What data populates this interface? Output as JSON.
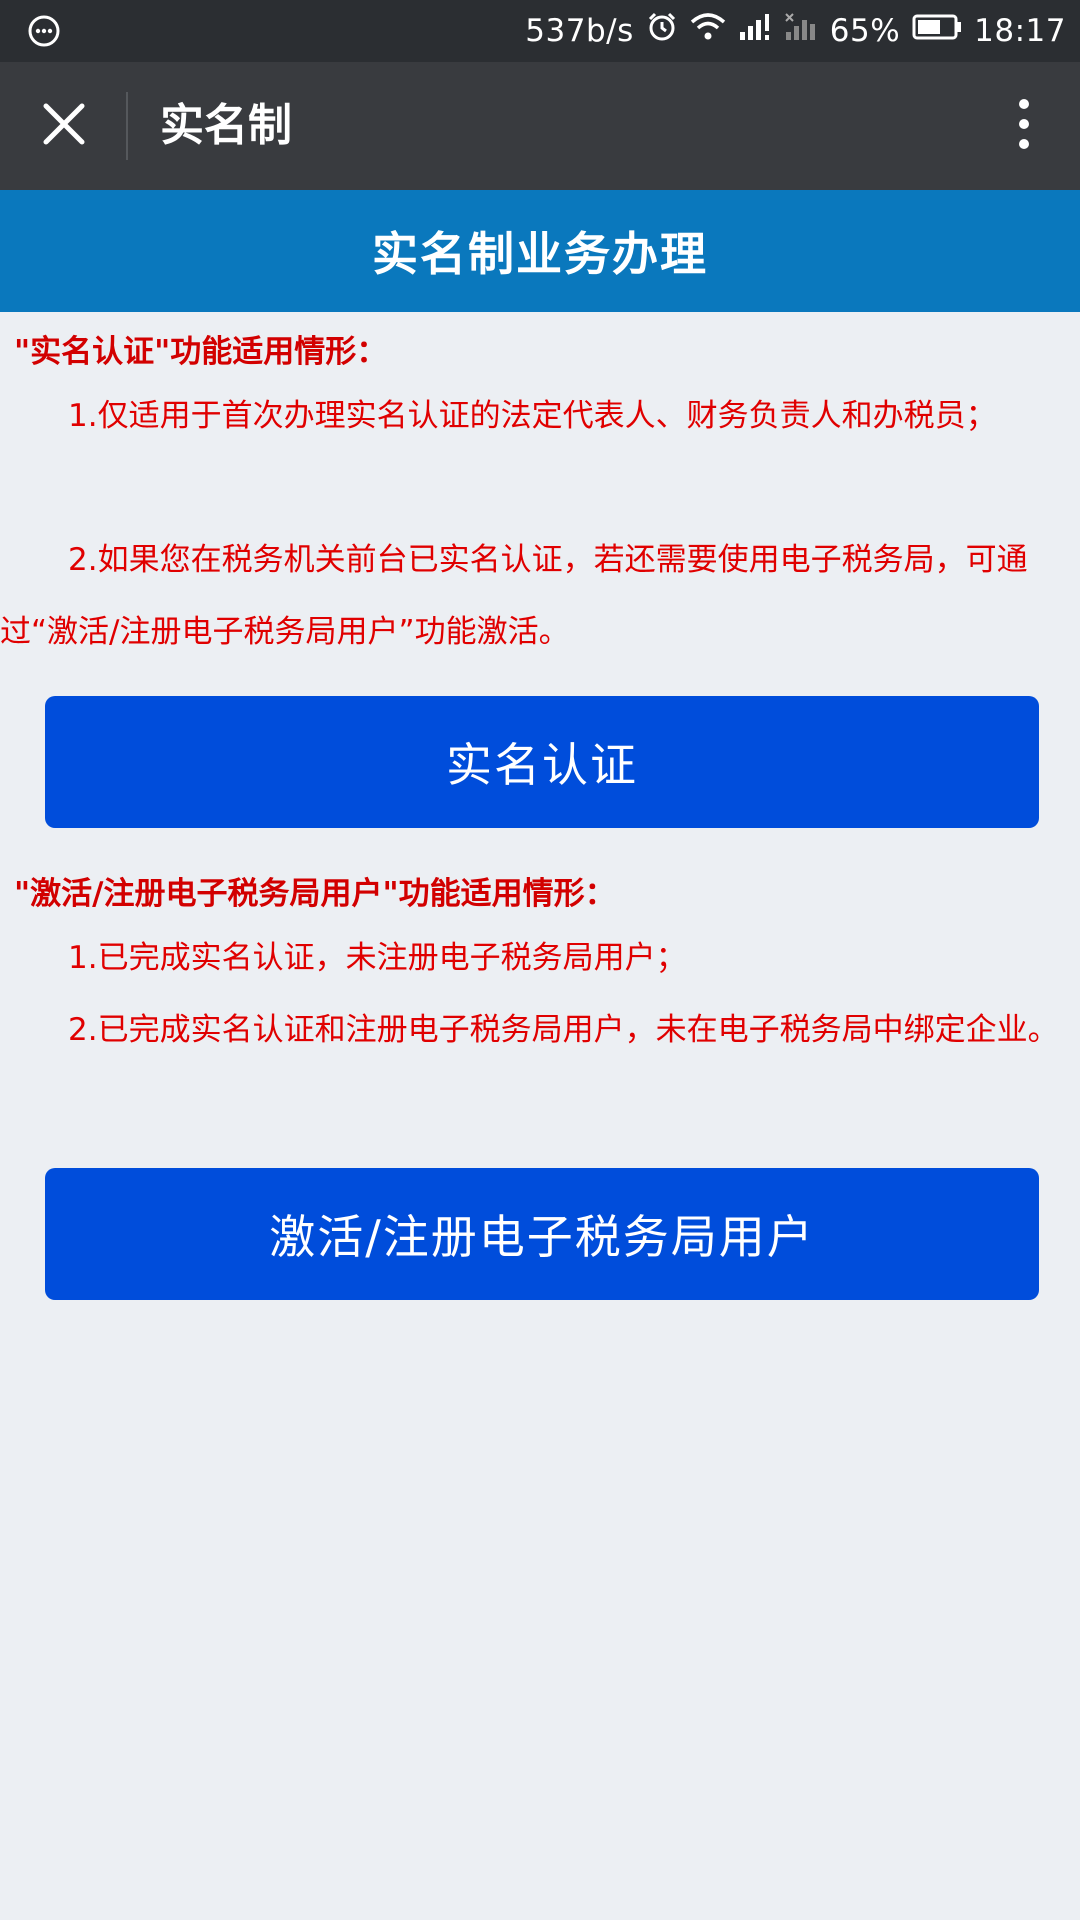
{
  "status_bar": {
    "net_speed": "537b/s",
    "battery_percent": "65%",
    "battery_level": 0.65,
    "time": "18:17",
    "icons": [
      "message-bubble-icon",
      "alarm-icon",
      "wifi-icon",
      "signal-icon",
      "signal-no-service-icon",
      "battery-icon"
    ]
  },
  "title_bar": {
    "title": "实名制"
  },
  "header": {
    "title": "实名制业务办理"
  },
  "section1": {
    "title": "\"实名认证\"功能适用情形：",
    "items": [
      "1.仅适用于首次办理实名认证的法定代表人、财务负责人和办税员；",
      "2.如果您在税务机关前台已实名认证，若还需要使用电子税务局，可通过“激活/注册电子税务局用户”功能激活。"
    ],
    "button": "实名认证"
  },
  "section2": {
    "title": "\"激活/注册电子税务局用户\"功能适用情形：",
    "items": [
      "1.已完成实名认证，未注册电子税务局用户；",
      "2.已完成实名认证和注册电子税务局用户，未在电子税务局中绑定企业。"
    ],
    "button": "激活/注册电子税务局用户"
  },
  "colors": {
    "status_bar": "#2b2e32",
    "title_bar": "#393b3f",
    "header": "#0a78bd",
    "text_red": "#e00000",
    "button": "#004ddb",
    "background": "#eceff3"
  }
}
